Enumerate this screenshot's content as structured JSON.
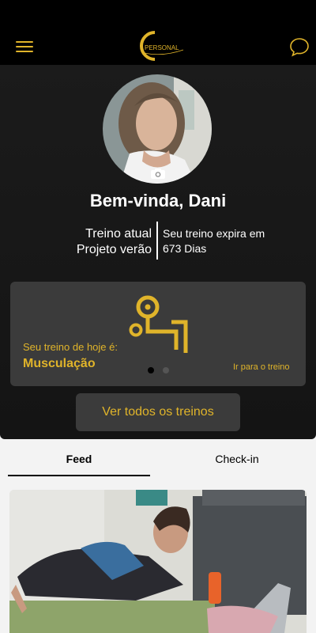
{
  "header": {
    "menu_icon": "hamburger-icon",
    "logo_text": "PERSONAL",
    "chat_icon": "chat-bubble-icon"
  },
  "profile": {
    "greeting": "Bem-vinda, Dani",
    "current_workout_label": "Treino atual",
    "current_workout_name": "Projeto verão",
    "expiry_line1": "Seu treino expira em",
    "expiry_line2": "673 Dias",
    "camera_icon": "camera-icon"
  },
  "today_card": {
    "label": "Seu treino de hoje é:",
    "workout": "Musculação",
    "link": "Ir para o treino",
    "icon": "weight-machine-icon",
    "pages": 2,
    "active_page": 1
  },
  "buttons": {
    "see_all": "Ver todos os treinos"
  },
  "tabs": [
    {
      "label": "Feed",
      "active": true
    },
    {
      "label": "Check-in",
      "active": false
    }
  ],
  "colors": {
    "accent": "#e0b42a",
    "dark_bg": "#141414",
    "card_bg": "#3b3b3b"
  }
}
